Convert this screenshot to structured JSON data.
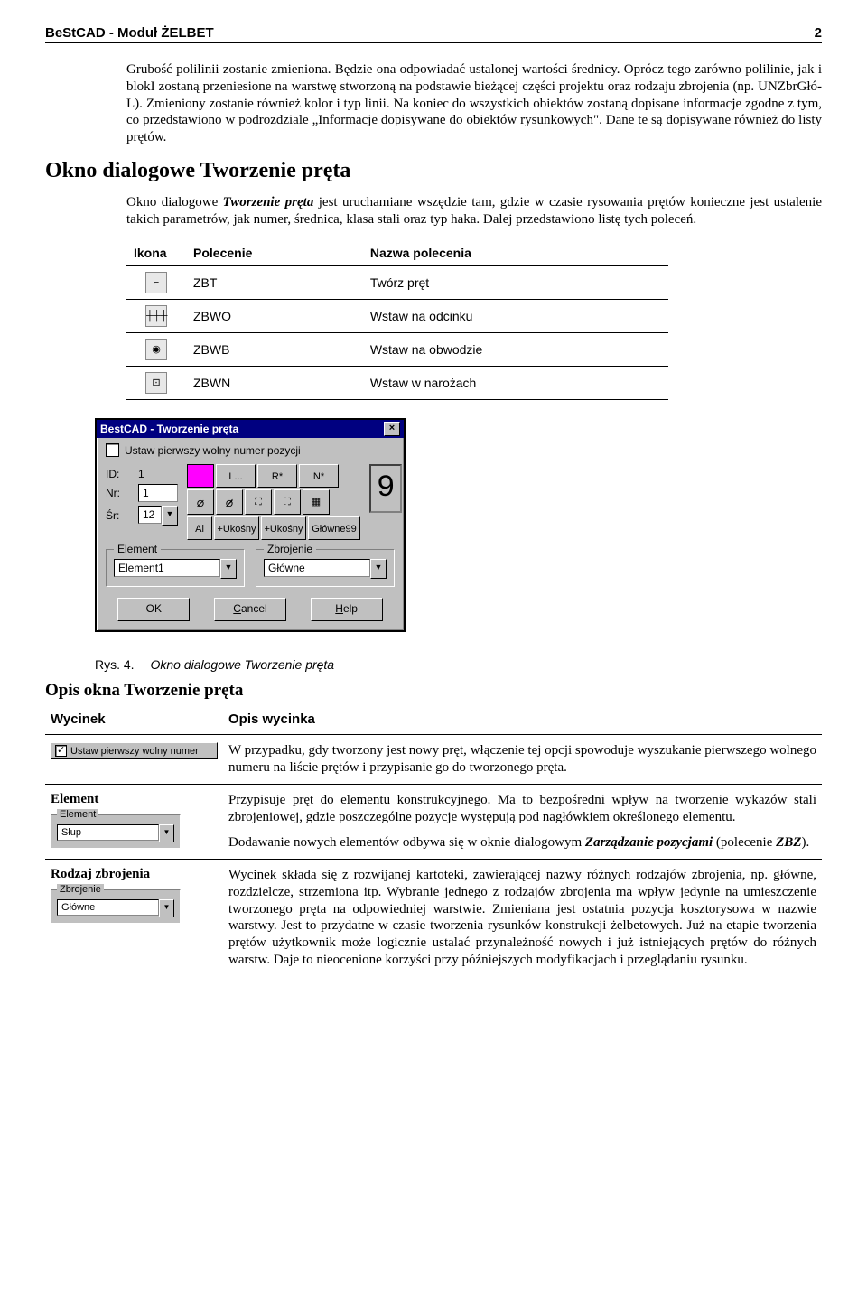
{
  "header": {
    "title": "BeStCAD - Moduł ŻELBET",
    "page": "2"
  },
  "para1": "Grubość polilinii zostanie zmieniona. Będzie ona odpowiadać ustalonej wartości średnicy. Oprócz tego zarówno polilinie, jak i blokI zostaną przeniesione na warstwę stworzoną na podstawie bieżącej części projektu oraz rodzaju zbrojenia (np. UNZbrGłó-L). Zmieniony zostanie również kolor i typ linii. Na koniec do wszystkich obiektów zostaną dopisane informacje zgodne z tym, co przedstawiono w podrozdziale „Informacje dopisywane do obiektów rysunkowych\". Dane te są dopisywane również do listy prętów.",
  "section_title": "Okno dialogowe Tworzenie pręta",
  "para2a": "Okno dialogowe ",
  "para2b": "Tworzenie pręta",
  "para2c": " jest uruchamiane wszędzie tam, gdzie w czasie rysowania prętów konieczne jest ustalenie takich parametrów, jak numer, średnica, klasa stali oraz typ haka. Dalej przedstawiono listę tych poleceń.",
  "cmd_headers": {
    "c1": "Ikona",
    "c2": "Polecenie",
    "c3": "Nazwa polecenia"
  },
  "cmds": [
    {
      "glyph": "⌐",
      "code": "ZBT",
      "name": "Twórz pręt"
    },
    {
      "glyph": "┼┼┼",
      "code": "ZBWO",
      "name": "Wstaw na odcinku"
    },
    {
      "glyph": "◉",
      "code": "ZBWB",
      "name": "Wstaw na obwodzie"
    },
    {
      "glyph": "⊡",
      "code": "ZBWN",
      "name": "Wstaw w narożach"
    }
  ],
  "dlg": {
    "title": "BestCAD - Tworzenie pręta",
    "chk_label": "Ustaw pierwszy wolny numer pozycji",
    "id_label": "ID:",
    "id_value": "1",
    "nr_label": "Nr:",
    "nr_value": "1",
    "sr_label": "Śr:",
    "sr_value": "12",
    "btn_L": "L...",
    "btn_R": "R*",
    "btn_N": "N*",
    "sel_Al": "Al",
    "sel_U1": "+Ukośny",
    "sel_U2": "+Ukośny",
    "sel_G99": "Główne99",
    "big_no": "9",
    "fs_element": "Element",
    "fs_element_val": "Element1",
    "fs_zbroj": "Zbrojenie",
    "fs_zbroj_val": "Główne",
    "ok": "OK",
    "cancel": "Cancel",
    "help": "Help"
  },
  "fig": {
    "label": "Rys. 4.",
    "caption": "Okno dialogowe Tworzenie pręta"
  },
  "subsection": "Opis okna Tworzenie pręta",
  "desc_headers": {
    "c1": "Wycinek",
    "c2": "Opis wycinka"
  },
  "row1": {
    "chk_text": "Ustaw pierwszy wolny numer",
    "desc": "W przypadku, gdy tworzony jest nowy pręt, włączenie tej opcji spowoduje wyszukanie pierwszego wolnego numeru na liście prętów i przypisanie go do tworzonego pręta."
  },
  "row2": {
    "title": "Element",
    "fs_label": "Element",
    "fs_value": "Słup",
    "p1": "Przypisuje pręt do elementu konstrukcyjnego. Ma to bezpośredni wpływ na tworzenie wykazów stali zbrojeniowej, gdzie poszczególne pozycje występują pod nagłówkiem określonego elementu.",
    "p2a": "Dodawanie nowych elementów odbywa się w oknie dialogowym ",
    "p2b": "Zarządzanie pozycjami",
    "p2c": " (polecenie ",
    "p2d": "ZBZ",
    "p2e": ")."
  },
  "row3": {
    "title": "Rodzaj zbrojenia",
    "fs_label": "Zbrojenie",
    "fs_value": "Główne",
    "desc": "Wycinek składa się z rozwijanej kartoteki, zawierającej nazwy różnych rodzajów zbrojenia, np. główne, rozdzielcze, strzemiona itp. Wybranie jednego z rodzajów zbrojenia ma wpływ jedynie na umieszczenie tworzonego pręta na odpowiedniej warstwie. Zmieniana jest ostatnia pozycja kosztorysowa w nazwie warstwy. Jest to przydatne w czasie tworzenia rysunków konstrukcji żelbetowych. Już na etapie tworzenia prętów użytkownik może logicznie ustalać przynależność nowych i już istniejących prętów do różnych warstw. Daje to nieocenione korzyści przy późniejszych modyfikacjach i przeglądaniu rysunku."
  }
}
